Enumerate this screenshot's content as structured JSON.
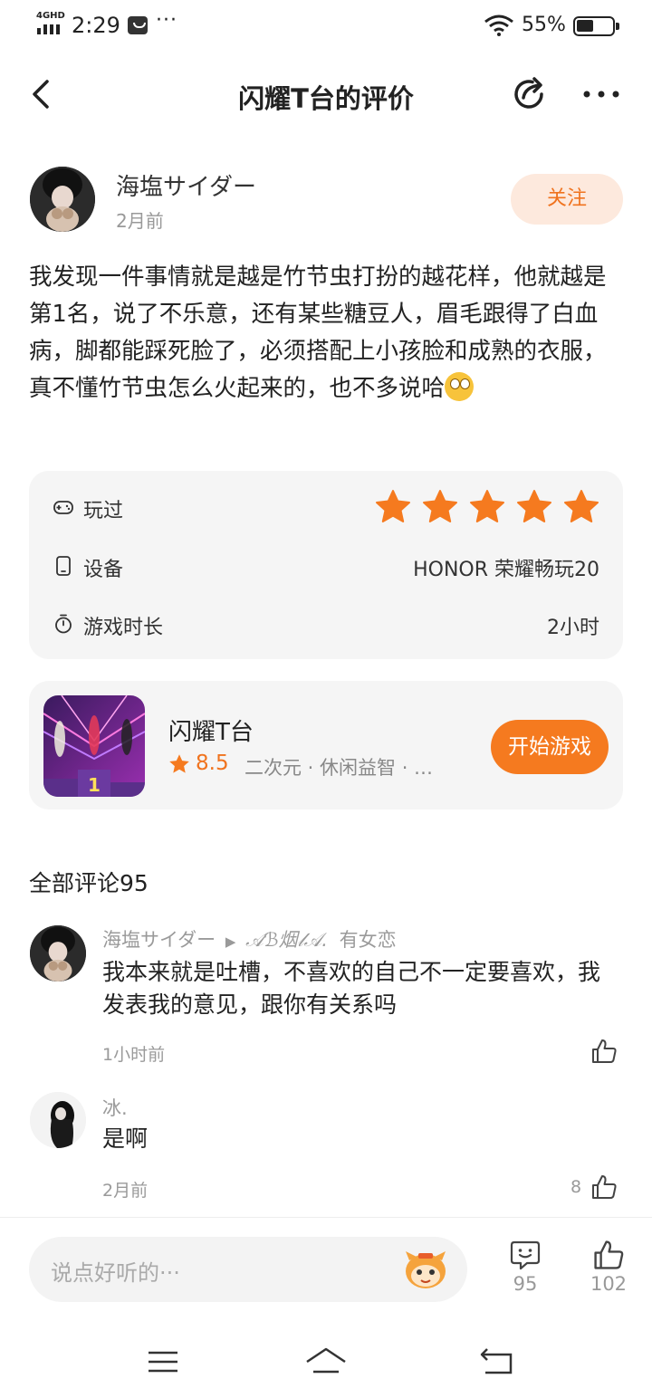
{
  "status_bar": {
    "network": "4GHD",
    "time": "2:29",
    "more": "···",
    "battery_percent": "55%"
  },
  "header": {
    "title": "闪耀T台的评价",
    "icons": {
      "back": "back-icon",
      "share": "share-icon",
      "more": "more-icon"
    }
  },
  "author": {
    "name": "海塩サイダー",
    "time": "2月前",
    "follow_label": "关注"
  },
  "review": {
    "text": "我发现一件事情就是越是竹节虫打扮的越花样，他就越是第1名，说了不乐意，还有某些糖豆人，眉毛跟得了白血病，脚都能踩死脸了，必须搭配上小孩脸和成熟的衣服，真不懂竹节虫怎么火起来的，也不多说哈",
    "emoji": "eye-roll-emoji"
  },
  "info": {
    "played_label": "玩过",
    "stars": 5,
    "device_label": "设备",
    "device_value": "HONOR 荣耀畅玩20",
    "duration_label": "游戏时长",
    "duration_value": "2小时"
  },
  "game": {
    "name": "闪耀T台",
    "rating": "8.5",
    "tags": "二次元 · 休闲益智 · …",
    "thumb_label": "1",
    "play_label": "开始游戏"
  },
  "comments": {
    "title": "全部评论95",
    "items": [
      {
        "user": "海塩サイダー",
        "reply_to": "𝒜ℬ烟𝓁𝒜.",
        "reply_suffix": "有女恋",
        "text": "我本来就是吐槽，不喜欢的自己不一定要喜欢，我发表我的意见，跟你有关系吗",
        "time": "1小时前",
        "likes": ""
      },
      {
        "user": "冰.",
        "reply_to": "",
        "reply_suffix": "",
        "text": "是啊",
        "time": "2月前",
        "likes": "8"
      }
    ]
  },
  "bottom_bar": {
    "placeholder": "说点好听的···",
    "comment_count": "95",
    "like_count": "102"
  },
  "colors": {
    "accent": "#f57a1f",
    "follow_bg": "#fde9dd",
    "card_bg": "#f5f5f5"
  }
}
